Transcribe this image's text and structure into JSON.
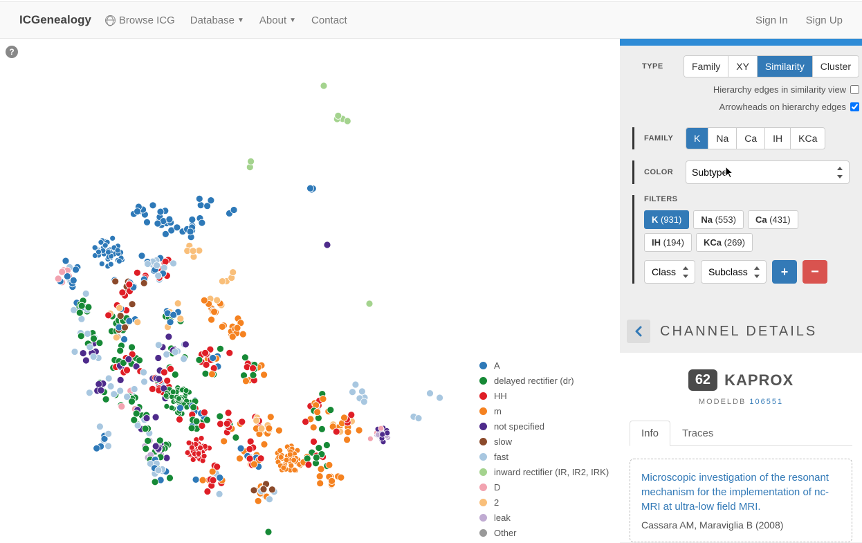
{
  "brand": "ICGenealogy",
  "nav": {
    "browse": "Browse ICG",
    "database": "Database",
    "about": "About",
    "contact": "Contact",
    "signin": "Sign In",
    "signup": "Sign Up"
  },
  "help": "?",
  "sidebar": {
    "type_label": "TYPE",
    "type_opts": [
      "Family",
      "XY",
      "Similarity",
      "Cluster"
    ],
    "type_active": "Similarity",
    "chk1": "Hierarchy edges in similarity view",
    "chk2": "Arrowheads on hierarchy edges",
    "family_label": "FAMILY",
    "family_opts": [
      "K",
      "Na",
      "Ca",
      "IH",
      "KCa"
    ],
    "family_active": "K",
    "color_label": "COLOR",
    "color_selected": "Subtype",
    "filters_label": "FILTERS",
    "filter_tags": [
      {
        "name": "K",
        "count": "(931)",
        "active": true
      },
      {
        "name": "Na",
        "count": "(553)",
        "active": false
      },
      {
        "name": "Ca",
        "count": "(431)",
        "active": false
      },
      {
        "name": "IH",
        "count": "(194)",
        "active": false
      },
      {
        "name": "KCa",
        "count": "(269)",
        "active": false
      }
    ],
    "sub1": "Class",
    "sub2": "Subclass",
    "plus": "+",
    "minus": "−"
  },
  "details": {
    "title": "CHANNEL DETAILS",
    "num": "62",
    "name": "KAPROX",
    "modeldb_label": "MODELDB",
    "modeldb_id": "106551",
    "tabs": [
      "Info",
      "Traces"
    ],
    "tab_active": "Info",
    "paper_title": "Microscopic investigation of the resonant mechanism for the implementation of nc-MRI at ultra-low field MRI.",
    "paper_auth": "Cassara AM, Maraviglia B (2008)"
  },
  "legend": [
    {
      "color": "#2E79B8",
      "label": "A"
    },
    {
      "color": "#168936",
      "label": "delayed rectifier (dr)"
    },
    {
      "color": "#DF1E26",
      "label": "HH"
    },
    {
      "color": "#F58220",
      "label": "m"
    },
    {
      "color": "#4E2B8B",
      "label": "not specified"
    },
    {
      "color": "#8B4A2B",
      "label": "slow"
    },
    {
      "color": "#A8C7E0",
      "label": "fast"
    },
    {
      "color": "#A4D38E",
      "label": "inward rectifier (IR, IR2, IRK)"
    },
    {
      "color": "#F2A3B0",
      "label": "D"
    },
    {
      "color": "#F9BF7A",
      "label": "2"
    },
    {
      "color": "#C0ABD2",
      "label": "leak"
    },
    {
      "color": "#999999",
      "label": "Other"
    }
  ]
}
